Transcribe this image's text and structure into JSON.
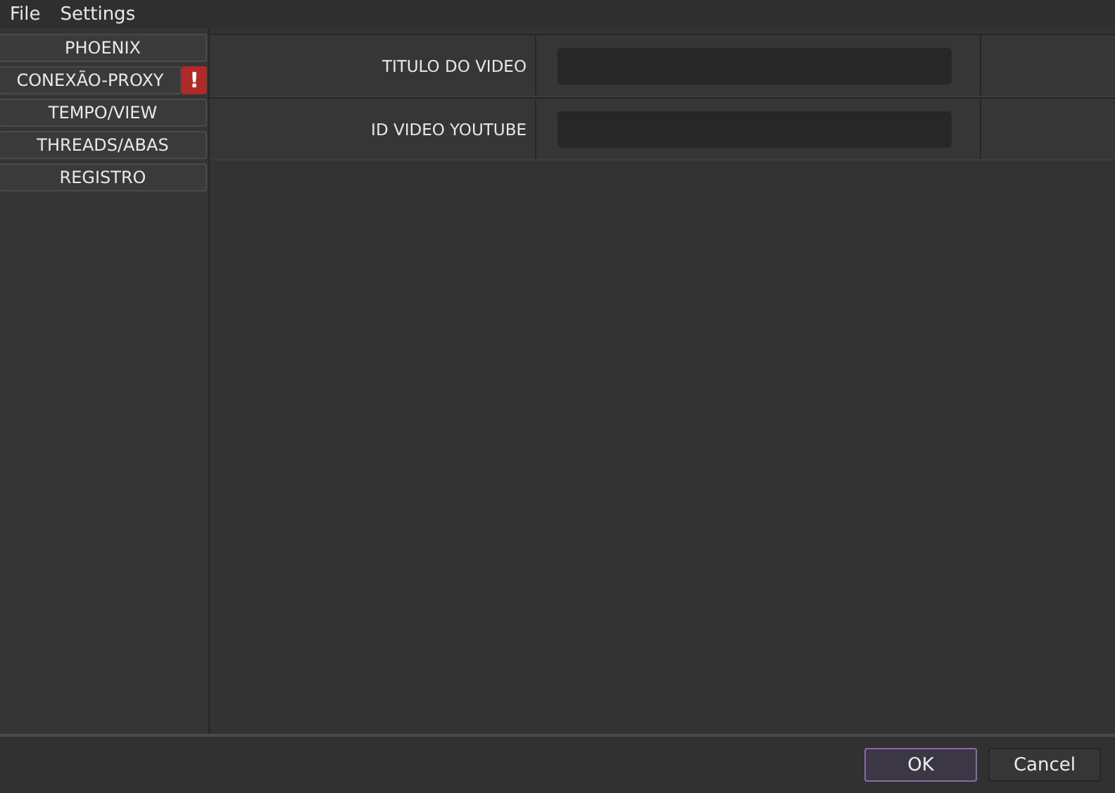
{
  "menu": [
    "File",
    "Settings"
  ],
  "sidebar": {
    "items": [
      {
        "label": "PHOENIX"
      },
      {
        "label": "CONEXÃO-PROXY",
        "badge": "!"
      },
      {
        "label": "TEMPO/VIEW"
      },
      {
        "label": "THREADS/ABAS"
      },
      {
        "label": "REGISTRO"
      }
    ]
  },
  "form": {
    "rows": [
      {
        "label": "TITULO DO VIDEO"
      },
      {
        "label": "ID VIDEO YOUTUBE"
      }
    ]
  },
  "buttons": [
    {
      "label": "OK",
      "default": true
    },
    {
      "label": "Cancel",
      "default": false
    }
  ]
}
